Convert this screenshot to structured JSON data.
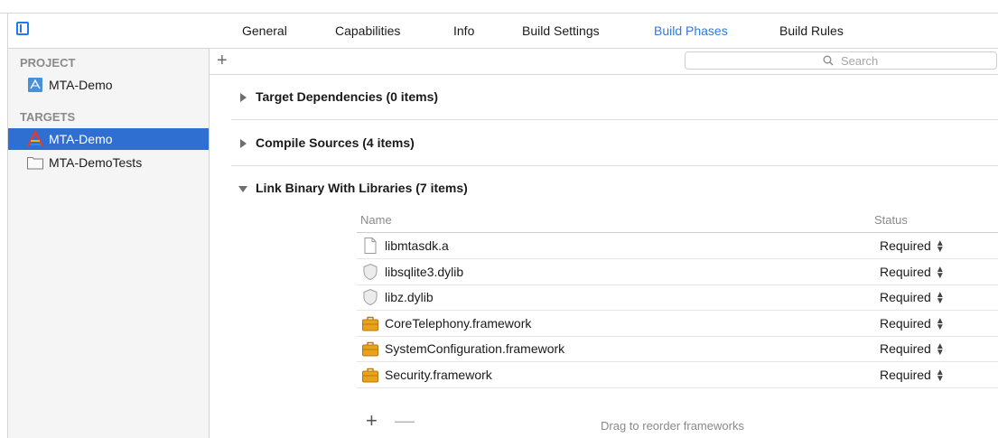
{
  "tabs": [
    {
      "label": "General"
    },
    {
      "label": "Capabilities"
    },
    {
      "label": "Info"
    },
    {
      "label": "Build Settings"
    },
    {
      "label": "Build Phases",
      "active": true
    },
    {
      "label": "Build Rules"
    }
  ],
  "sidebar": {
    "project_header": "PROJECT",
    "project_items": [
      {
        "label": "MTA-Demo",
        "icon": "project-blueprint-icon"
      }
    ],
    "targets_header": "TARGETS",
    "target_items": [
      {
        "label": "MTA-Demo",
        "icon": "app-target-icon",
        "selected": true
      },
      {
        "label": "MTA-DemoTests",
        "icon": "test-bundle-icon"
      }
    ]
  },
  "toolbar": {
    "add_label": "+",
    "search_placeholder": "Search",
    "search_icon": "magnifier-icon"
  },
  "phases": [
    {
      "title": "Target Dependencies (0 items)",
      "expanded": false
    },
    {
      "title": "Compile Sources (4 items)",
      "expanded": false
    },
    {
      "title": "Link Binary With Libraries (7 items)",
      "expanded": true
    }
  ],
  "libraries": {
    "columns": {
      "name": "Name",
      "status": "Status"
    },
    "rows": [
      {
        "name": "libmtasdk.a",
        "status": "Required",
        "icon": "document-icon"
      },
      {
        "name": "libsqlite3.dylib",
        "status": "Required",
        "icon": "dylib-shield-icon"
      },
      {
        "name": "libz.dylib",
        "status": "Required",
        "icon": "dylib-shield-icon"
      },
      {
        "name": "CoreTelephony.framework",
        "status": "Required",
        "icon": "framework-toolbox-icon"
      },
      {
        "name": "SystemConfiguration.framework",
        "status": "Required",
        "icon": "framework-toolbox-icon"
      },
      {
        "name": "Security.framework",
        "status": "Required",
        "icon": "framework-toolbox-icon"
      }
    ],
    "add_label": "+",
    "remove_label": "—",
    "footer_hint": "Drag to reorder frameworks"
  },
  "colors": {
    "accent": "#2f7be0",
    "selection": "#2f6fd1",
    "framework_gold": "#e9a21b"
  }
}
